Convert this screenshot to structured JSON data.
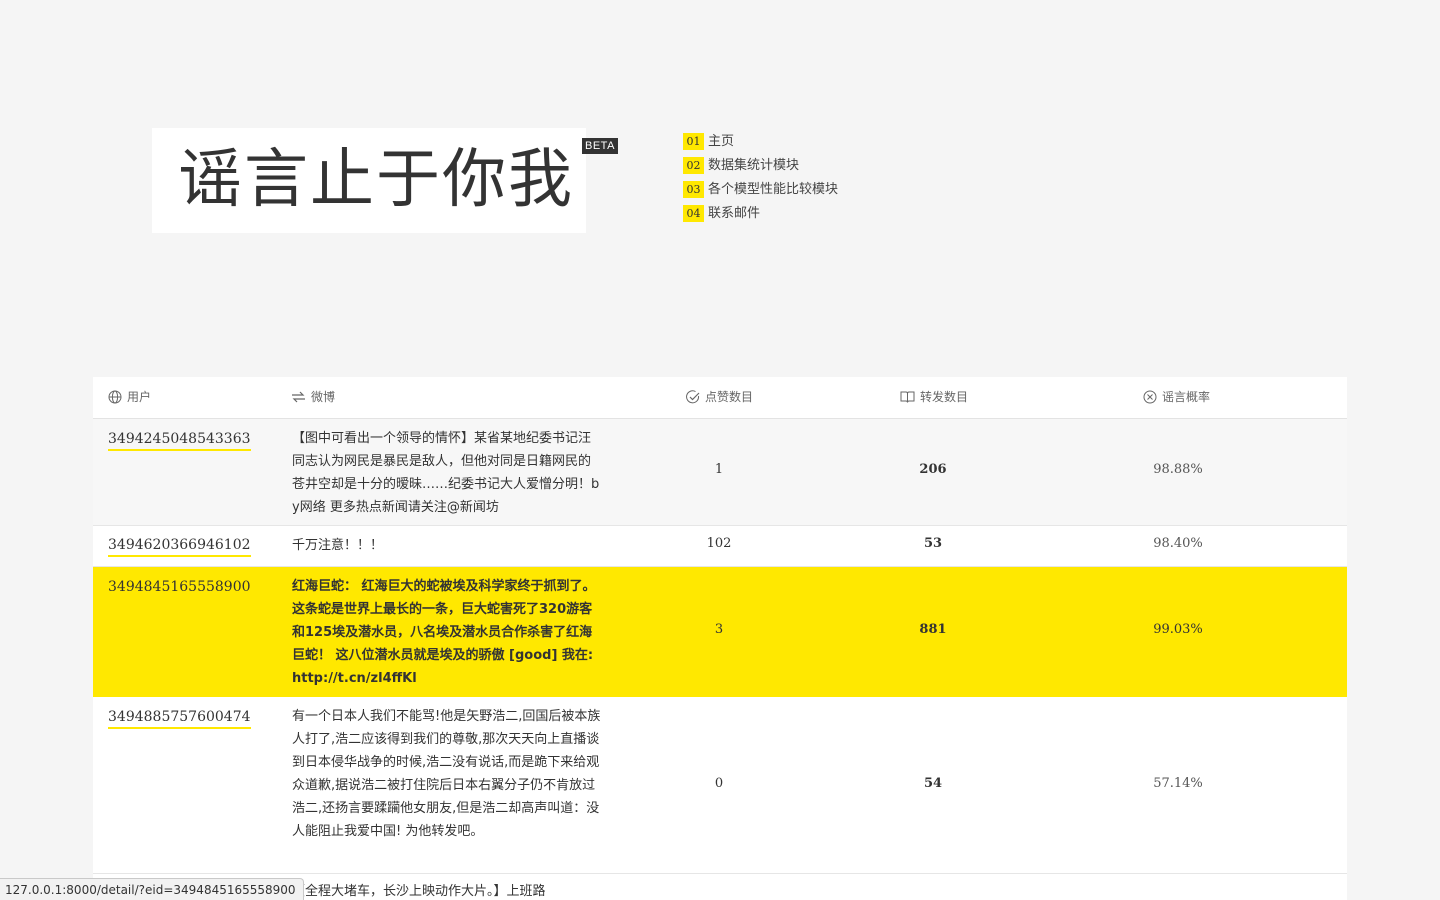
{
  "logo": {
    "title": "谣言止于你我",
    "badge": "BETA"
  },
  "nav": [
    {
      "num": "01",
      "label": "主页"
    },
    {
      "num": "02",
      "label": "数据集统计模块"
    },
    {
      "num": "03",
      "label": "各个模型性能比较模块"
    },
    {
      "num": "04",
      "label": "联系邮件"
    }
  ],
  "table": {
    "headers": {
      "user": "用户",
      "weibo": "微博",
      "likes": "点赞数目",
      "forwards": "转发数目",
      "rumor": "谣言概率"
    },
    "header_icons": {
      "user": "globe-icon",
      "weibo": "repost-icon",
      "likes": "check-circle-icon",
      "forwards": "book-icon",
      "rumor": "x-circle-icon"
    },
    "rows": [
      {
        "user": "3494245048543363",
        "text": "【图中可看出一个领导的情怀】某省某地纪委书记汪同志认为网民是暴民是敌人，但他对同是日籍网民的苍井空却是十分的暧昧……纪委书记大人爱憎分明！by网络 更多热点新闻请关注@新闻坊",
        "likes": "1",
        "forwards": "206",
        "rumor": "98.88%"
      },
      {
        "user": "3494620366946102",
        "text": "千万注意！！！",
        "likes": "102",
        "forwards": "53",
        "rumor": "98.40%"
      },
      {
        "user": "3494845165558900",
        "text": "红海巨蛇： 红海巨大的蛇被埃及科学家终于抓到了。 这条蛇是世界上最长的一条，巨大蛇害死了320游客和125埃及潜水员，八名埃及潜水员合作杀害了红海巨蛇！ 这八位潜水员就是埃及的骄傲 [good] 我在:http://t.cn/zl4ffKl",
        "likes": "3",
        "forwards": "881",
        "rumor": "99.03%"
      },
      {
        "user": "3494885757600474",
        "text": "有一个日本人我们不能骂!他是矢野浩二,回国后被本族人打了,浩二应该得到我们的尊敬,那次天天向上直播谈到日本侵华战争的时候,浩二没有说话,而是跪下来给观众道歉,据说浩二被打住院后日本右翼分子仍不肯放过浩二,还扬言要蹂躏他女朋友,但是浩二却高声叫道：没人能阻止我爱中国! 为他转发吧。",
        "likes": "0",
        "forwards": "54",
        "rumor": "57.14%"
      },
      {
        "user": "",
        "text": "【全程大堵车，长沙上映动作大片。】上班路",
        "likes": "",
        "forwards": "",
        "rumor": ""
      }
    ]
  },
  "status_url": "127.0.0.1:8000/detail/?eid=3494845165558900",
  "colors": {
    "accent": "#ffe800",
    "text": "#333333",
    "background": "#f5f5f5"
  }
}
